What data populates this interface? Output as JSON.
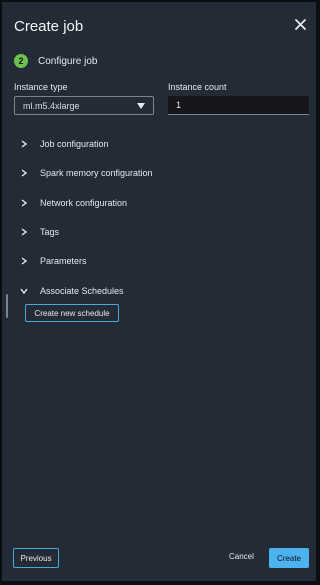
{
  "dialog": {
    "title": "Create job",
    "close_icon": "close-icon"
  },
  "step": {
    "number": "2",
    "label": "Configure job",
    "color": "#6cc24a"
  },
  "fields": {
    "instance_type_label": "Instance type",
    "instance_type_value": "ml.m5.4xlarge",
    "instance_count_label": "Instance count",
    "instance_count_value": "1"
  },
  "sections": [
    {
      "label": "Job configuration",
      "expanded": false
    },
    {
      "label": "Spark memory configuration",
      "expanded": false
    },
    {
      "label": "Network configuration",
      "expanded": false
    },
    {
      "label": "Tags",
      "expanded": false
    },
    {
      "label": "Parameters",
      "expanded": false
    },
    {
      "label": "Associate Schedules",
      "expanded": true
    }
  ],
  "schedules": {
    "create_button": "Create new schedule"
  },
  "footer": {
    "previous": "Previous",
    "cancel": "Cancel",
    "create": "Create"
  },
  "colors": {
    "background": "#232b37",
    "accent": "#4cb3ee"
  }
}
